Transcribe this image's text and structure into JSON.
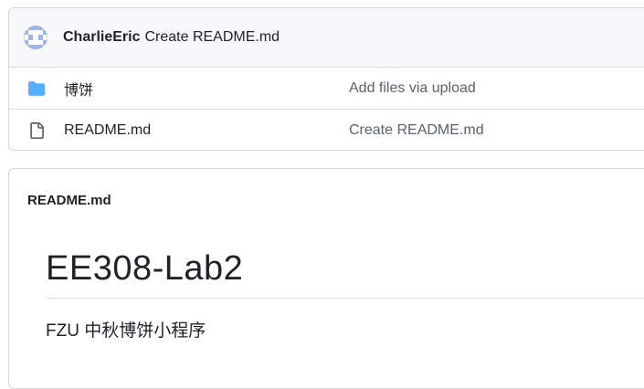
{
  "commit": {
    "author": "CharlieEric",
    "message": "Create README.md"
  },
  "files": [
    {
      "name": "博饼",
      "type": "folder",
      "icon": "folder-icon",
      "commit_message": "Add files via upload"
    },
    {
      "name": "README.md",
      "type": "file",
      "icon": "file-icon",
      "commit_message": "Create README.md"
    }
  ],
  "readme": {
    "filename": "README.md",
    "title": "EE308-Lab2",
    "description": "FZU 中秋博饼小程序"
  },
  "colors": {
    "folder": "#54aeff",
    "border": "#d0d7de",
    "muted_text": "#59636e",
    "avatar": "#9db4e8"
  }
}
